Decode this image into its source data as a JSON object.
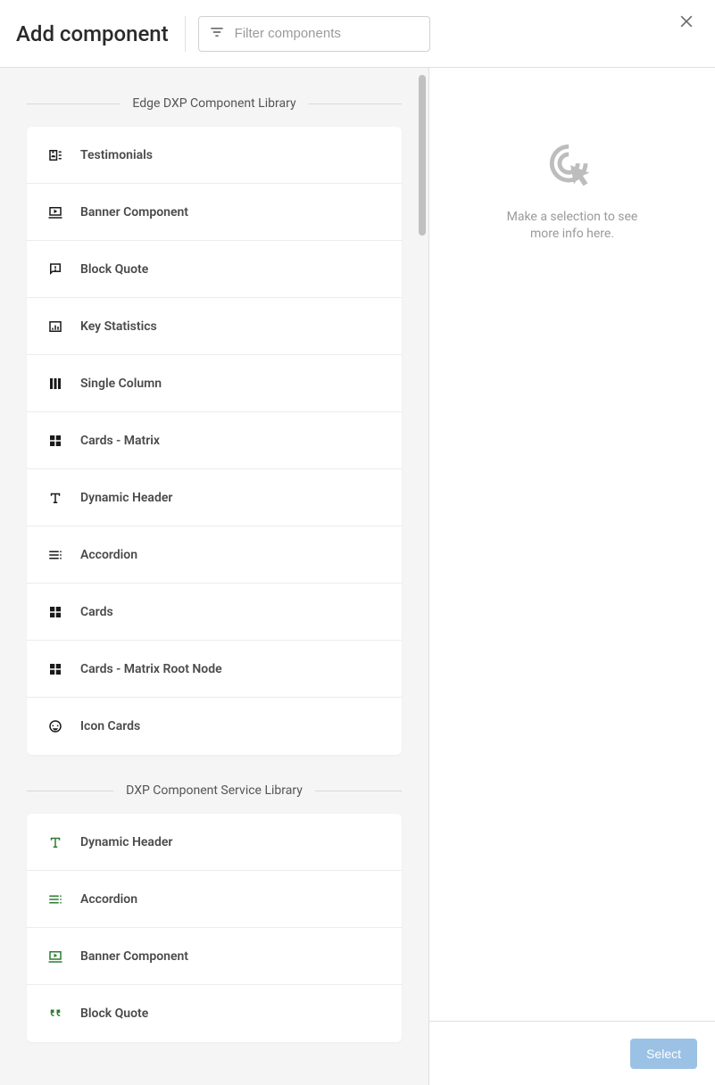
{
  "header": {
    "title": "Add component",
    "filterPlaceholder": "Filter components"
  },
  "libraries": [
    {
      "name": "Edge DXP Component Library",
      "iconStyle": "dark",
      "items": [
        {
          "icon": "testimonial",
          "label": "Testimonials"
        },
        {
          "icon": "banner",
          "label": "Banner Component"
        },
        {
          "icon": "quote-warn",
          "label": "Block Quote"
        },
        {
          "icon": "stats",
          "label": "Key Statistics"
        },
        {
          "icon": "single-col",
          "label": "Single Column"
        },
        {
          "icon": "matrix",
          "label": "Cards - Matrix"
        },
        {
          "icon": "text-t",
          "label": "Dynamic Header"
        },
        {
          "icon": "accordion",
          "label": "Accordion"
        },
        {
          "icon": "matrix",
          "label": "Cards"
        },
        {
          "icon": "matrix",
          "label": "Cards - Matrix Root Node"
        },
        {
          "icon": "face",
          "label": "Icon Cards"
        }
      ]
    },
    {
      "name": "DXP Component Service Library",
      "iconStyle": "green",
      "items": [
        {
          "icon": "text-t",
          "label": "Dynamic Header"
        },
        {
          "icon": "accordion",
          "label": "Accordion"
        },
        {
          "icon": "banner",
          "label": "Banner Component"
        },
        {
          "icon": "quote-mark",
          "label": "Block Quote"
        }
      ]
    }
  ],
  "right": {
    "emptyText": "Make a selection to see more info here."
  },
  "footer": {
    "selectLabel": "Select"
  }
}
